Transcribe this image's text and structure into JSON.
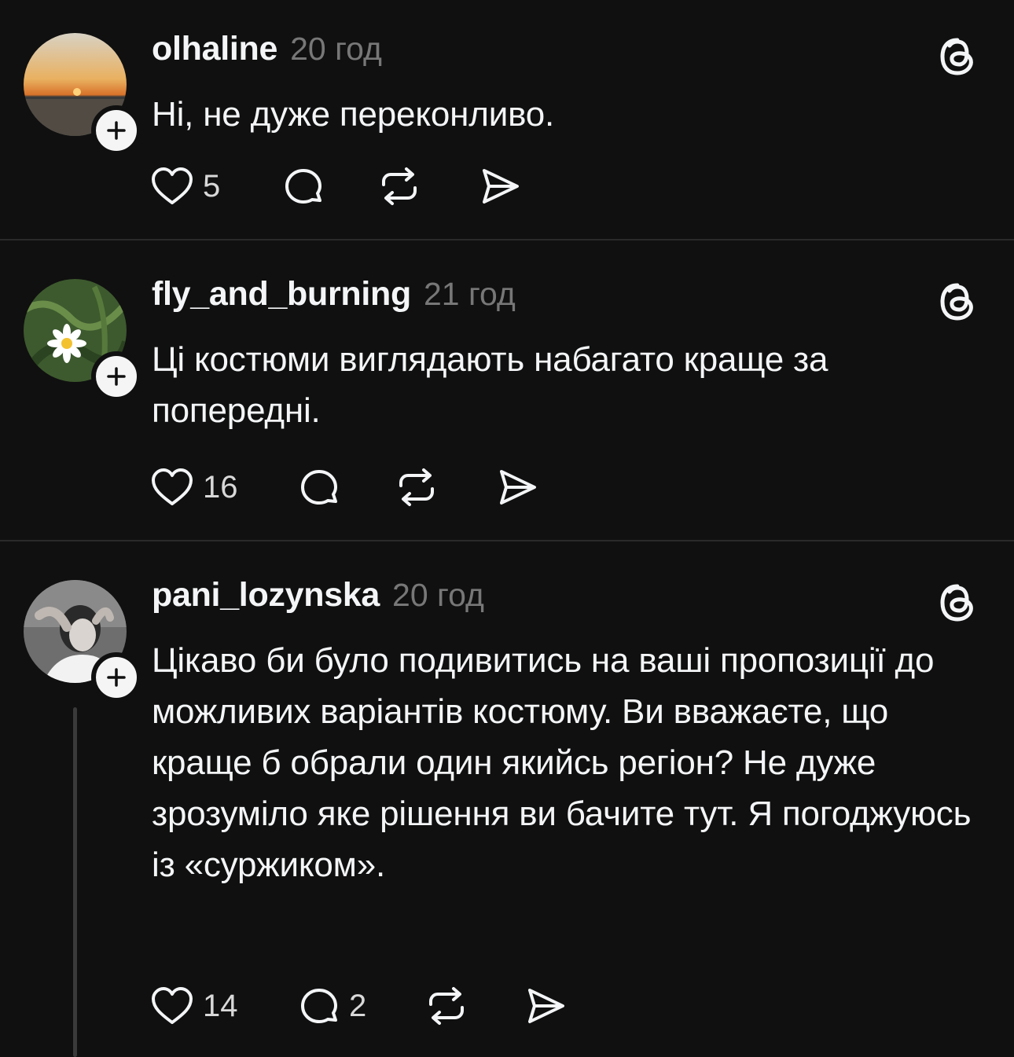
{
  "posts": [
    {
      "username": "olhaline",
      "time": "20 год",
      "text": "Ні, не дуже переконливо.",
      "likes": "5",
      "replies": ""
    },
    {
      "username": "fly_and_burning",
      "time": "21 год",
      "text": "Ці костюми виглядають набагато краще за попередні.",
      "likes": "16",
      "replies": ""
    },
    {
      "username": "pani_lozynska",
      "time": "20 год",
      "text": "Цікаво би було подивитись на ваші пропозиції до можливих варіантів костюму. Ви вважаєте, що краще б обрали один якийсь регіон? Не дуже зрозуміло яке рішення ви бачите тут. Я погоджуюсь із «суржиком».",
      "likes": "14",
      "replies": "2"
    }
  ],
  "icons": {
    "like": "heart-icon",
    "reply": "comment-icon",
    "repost": "repost-icon",
    "share": "share-icon",
    "follow": "plus-icon",
    "app": "threads-icon"
  },
  "colors": {
    "background": "#101010",
    "text": "#f3f5f7",
    "muted": "#777777",
    "divider": "#2a2a2a"
  }
}
